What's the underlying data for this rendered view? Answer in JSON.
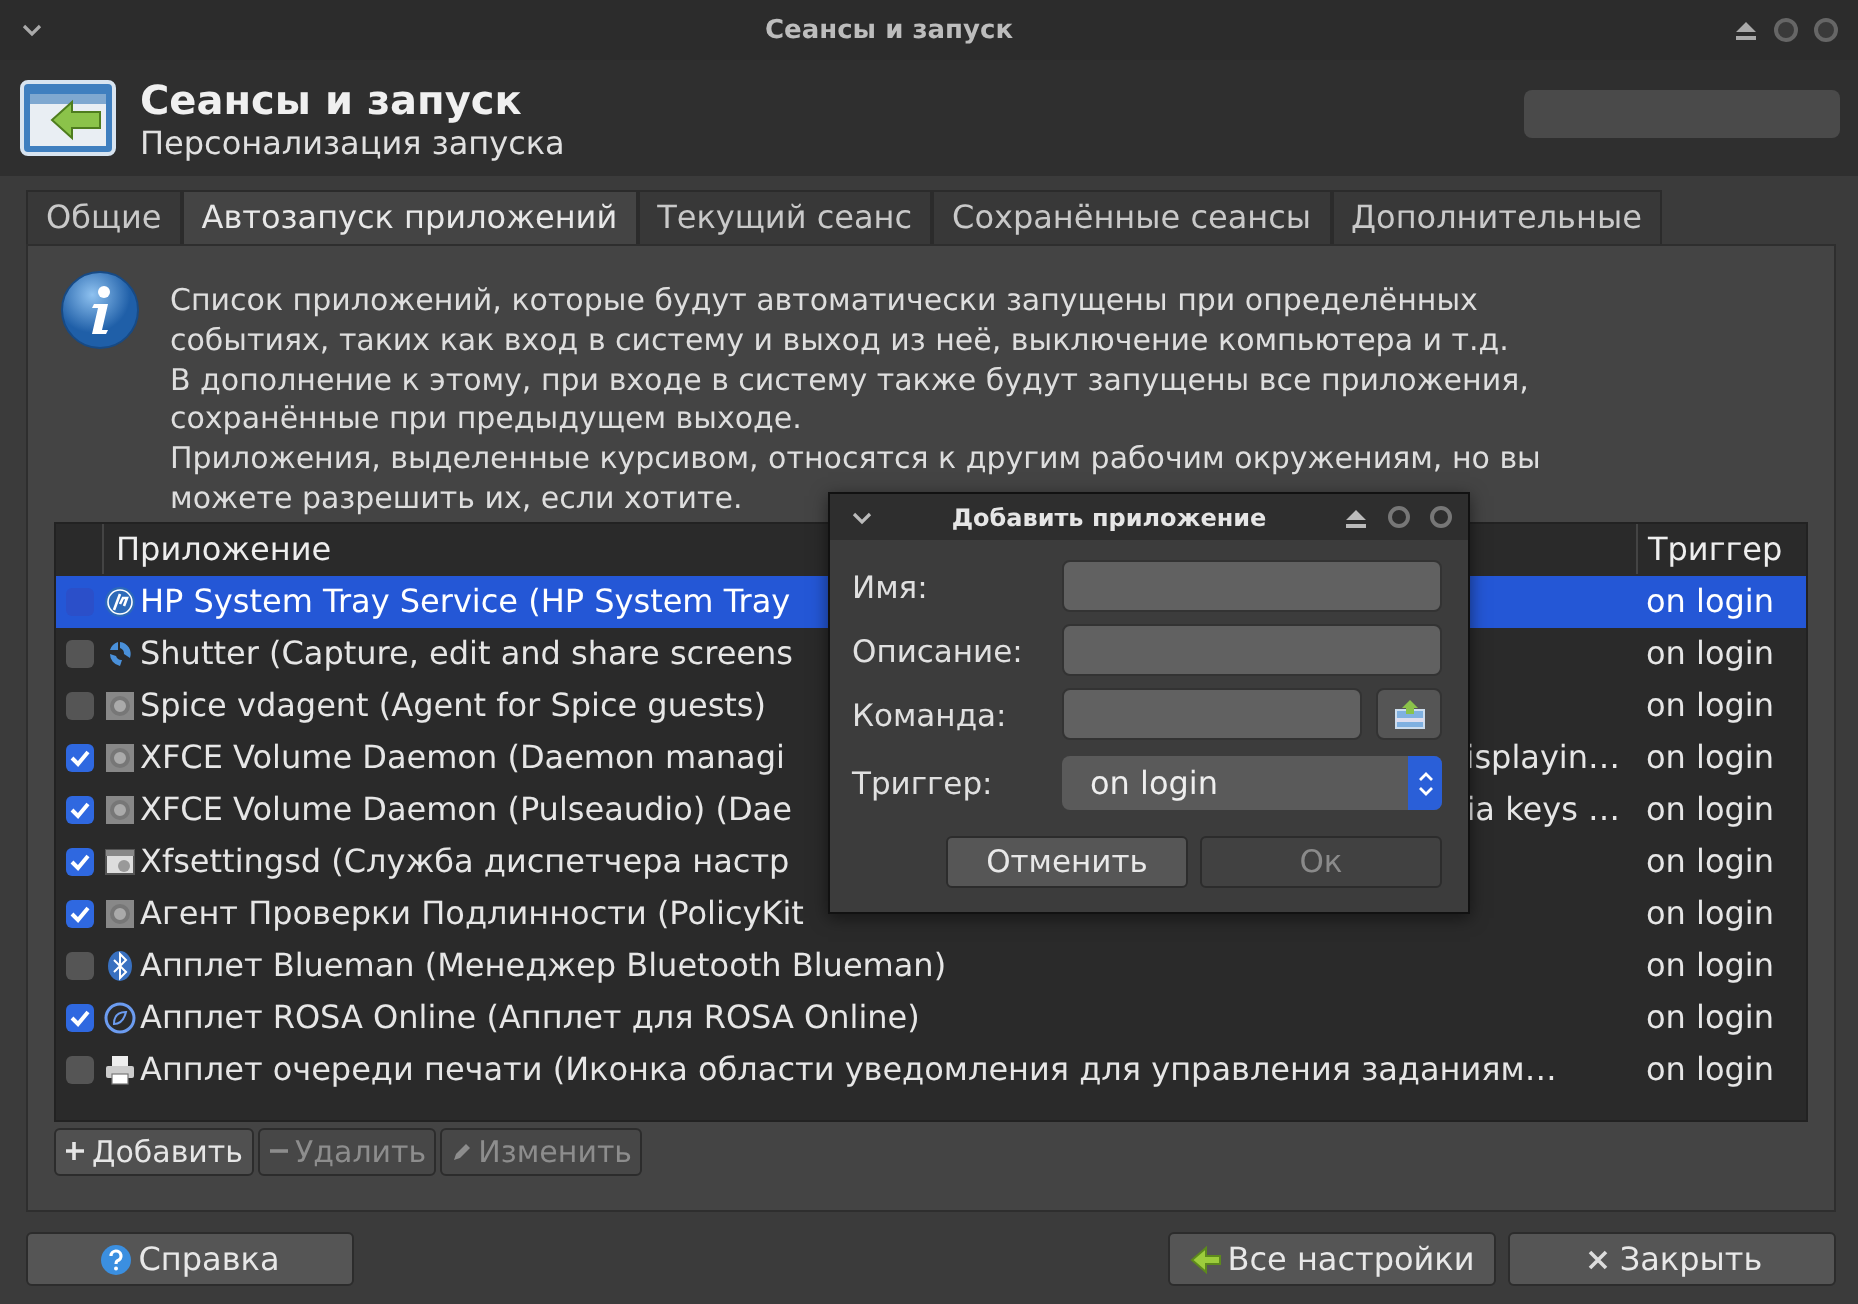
{
  "window": {
    "title": "Сеансы и запуск"
  },
  "header": {
    "title": "Сеансы и запуск",
    "subtitle": "Персонализация запуска"
  },
  "tabs": [
    {
      "label": "Общие",
      "selected": false
    },
    {
      "label": "Автозапуск приложений",
      "selected": true
    },
    {
      "label": "Текущий сеанс",
      "selected": false
    },
    {
      "label": "Сохранённые сеансы",
      "selected": false
    },
    {
      "label": "Дополнительные",
      "selected": false
    }
  ],
  "info": [
    "Список приложений, которые будут автоматически запущены при определённых",
    "событиях, таких как вход в систему и выход из неё, выключение компьютера и т.д.",
    "В дополнение к этому, при входе в систему также будут запущены все приложения,",
    "сохранённые при предыдущем выходе.",
    "Приложения, выделенные курсивом, относятся к другим рабочим окружениям, но вы",
    "можете разрешить их, если хотите."
  ],
  "table": {
    "columns": [
      "Приложение",
      "Триггер"
    ],
    "rows": [
      {
        "name": "HP System Tray Service (HP System Tray",
        "trigger": "on login",
        "checked": false,
        "selected": true
      },
      {
        "name": "Shutter (Capture, edit and share screens",
        "trigger": "on login",
        "checked": false,
        "selected": false
      },
      {
        "name": "Spice vdagent (Agent for Spice guests)",
        "trigger": "on login",
        "checked": false,
        "selected": false
      },
      {
        "name": "XFCE Volume Daemon (Daemon managi",
        "name_tail": "isplayin…",
        "trigger": "on login",
        "checked": true,
        "selected": false
      },
      {
        "name": "XFCE Volume Daemon (Pulseaudio) (Dae",
        "name_tail": "ia keys …",
        "trigger": "on login",
        "checked": true,
        "selected": false
      },
      {
        "name": "Xfsettingsd (Служба диспетчера настр",
        "trigger": "on login",
        "checked": true,
        "selected": false
      },
      {
        "name": "Агент Проверки Подлинности (PolicyKit",
        "trigger": "on login",
        "checked": true,
        "selected": false
      },
      {
        "name": "Апплет Blueman (Менеджер Bluetooth Blueman)",
        "trigger": "on login",
        "checked": false,
        "selected": false
      },
      {
        "name": "Апплет ROSA Online (Апплет для ROSA Online)",
        "trigger": "on login",
        "checked": true,
        "selected": false
      },
      {
        "name": "Апплет очереди печати (Иконка области уведомления для управления заданиям…",
        "trigger": "on login",
        "checked": false,
        "selected": false
      }
    ]
  },
  "list_buttons": [
    {
      "label": "Добавить",
      "kind": "add",
      "disabled": false
    },
    {
      "label": "Удалить",
      "kind": "remove",
      "disabled": true
    },
    {
      "label": "Изменить",
      "kind": "edit",
      "disabled": true
    }
  ],
  "footer_buttons": [
    {
      "label": "Справка",
      "kind": "help"
    },
    {
      "label": "Все настройки",
      "kind": "settings"
    },
    {
      "label": "Закрыть",
      "kind": "close"
    }
  ],
  "dialog": {
    "title": "Добавить приложение",
    "fields": [
      {
        "label": "Имя:",
        "kind": "text"
      },
      {
        "label": "Описание:",
        "kind": "text"
      },
      {
        "label": "Команда:",
        "kind": "file"
      },
      {
        "label": "Триггер:",
        "kind": "select",
        "value": "on login"
      }
    ],
    "buttons": [
      {
        "label": "Отменить",
        "disabled": false
      },
      {
        "label": "Ок",
        "disabled": true
      }
    ]
  }
}
